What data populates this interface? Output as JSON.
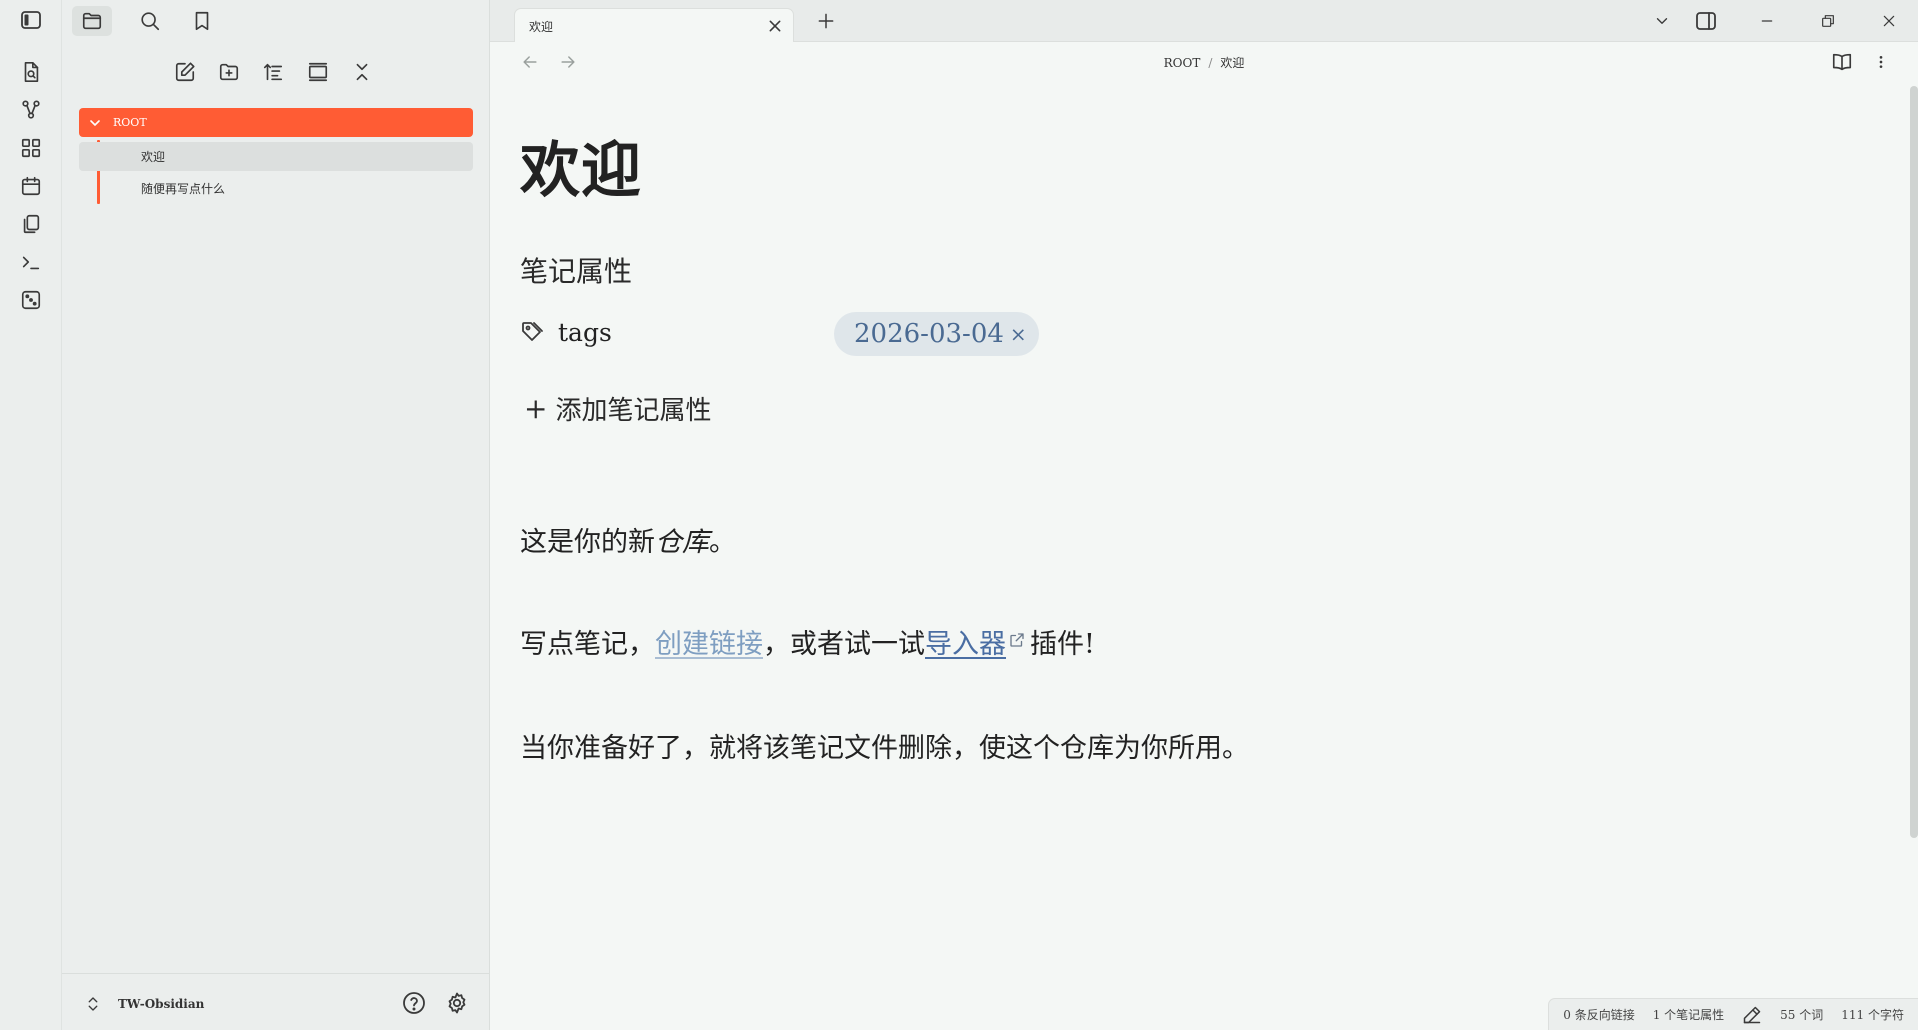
{
  "sidebar": {
    "tree": {
      "root_label": "ROOT",
      "items": [
        {
          "label": "欢迎",
          "selected": true
        },
        {
          "label": "随便再写点什么",
          "selected": false
        }
      ]
    },
    "vault_name": "TW-Obsidian"
  },
  "tabs": [
    {
      "title": "欢迎",
      "active": true
    }
  ],
  "breadcrumb": {
    "folder": "ROOT",
    "separator": "/",
    "note": "欢迎"
  },
  "note": {
    "title": "欢迎",
    "properties_heading": "笔记属性",
    "properties": [
      {
        "key": "tags",
        "value": "2026-03-04",
        "remove": "×"
      }
    ],
    "add_property_plus": "+",
    "add_property_label": "添加笔记属性",
    "p1": {
      "before": "这是你的新",
      "italic": "仓库",
      "after": "。"
    },
    "p2": {
      "before": "写点笔记，",
      "link1": "创建链接",
      "middle": "，或者试一试",
      "link2": "导入器",
      "after": "插件!"
    },
    "p3": "当你准备好了，就将该笔记文件删除，使这个仓库为你所用。"
  },
  "status": {
    "backlinks": "0 条反向链接",
    "properties": "1 个笔记属性",
    "words": "55 个词",
    "chars": "111 个字符"
  },
  "accent_color": "#ff5c34",
  "link_color": "#4a6ea3"
}
